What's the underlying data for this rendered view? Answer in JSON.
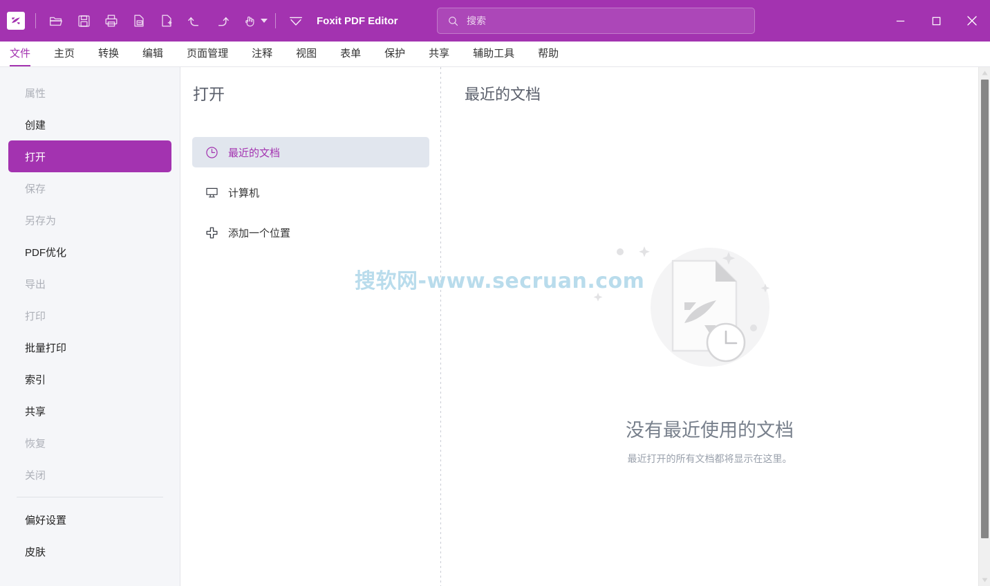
{
  "titlebar": {
    "app_name": "Foxit PDF Editor",
    "logo_icon": "foxit-logo-icon",
    "tools": [
      {
        "name": "open-file-icon",
        "label": "打开"
      },
      {
        "name": "save-icon",
        "label": "保存"
      },
      {
        "name": "print-icon",
        "label": "打印"
      },
      {
        "name": "document-properties-icon",
        "label": "属性"
      },
      {
        "name": "new-document-icon",
        "label": "新建"
      },
      {
        "name": "undo-icon",
        "label": "撤销"
      },
      {
        "name": "redo-icon",
        "label": "重做"
      },
      {
        "name": "hand-tool-icon",
        "label": "手形工具"
      }
    ],
    "customize_icon": "customize-toolbar-icon",
    "window_buttons": [
      {
        "name": "minimize-button",
        "glyph": "minimize"
      },
      {
        "name": "maximize-button",
        "glyph": "maximize"
      },
      {
        "name": "close-button",
        "glyph": "close"
      }
    ]
  },
  "search": {
    "placeholder": "搜索",
    "value": "",
    "icon": "search-icon"
  },
  "menubar": {
    "active": "文件",
    "items": [
      {
        "label": "文件",
        "active": true
      },
      {
        "label": "主页",
        "active": false
      },
      {
        "label": "转换",
        "active": false
      },
      {
        "label": "编辑",
        "active": false
      },
      {
        "label": "页面管理",
        "active": false
      },
      {
        "label": "注释",
        "active": false
      },
      {
        "label": "视图",
        "active": false
      },
      {
        "label": "表单",
        "active": false
      },
      {
        "label": "保护",
        "active": false
      },
      {
        "label": "共享",
        "active": false
      },
      {
        "label": "辅助工具",
        "active": false
      },
      {
        "label": "帮助",
        "active": false
      }
    ]
  },
  "sidebar": {
    "items": [
      {
        "label": "属性",
        "state": "disabled"
      },
      {
        "label": "创建",
        "state": "normal"
      },
      {
        "label": "打开",
        "state": "active"
      },
      {
        "label": "保存",
        "state": "disabled"
      },
      {
        "label": "另存为",
        "state": "disabled"
      },
      {
        "label": "PDF优化",
        "state": "normal"
      },
      {
        "label": "导出",
        "state": "disabled"
      },
      {
        "label": "打印",
        "state": "disabled"
      },
      {
        "label": "批量打印",
        "state": "normal"
      },
      {
        "label": "索引",
        "state": "normal"
      },
      {
        "label": "共享",
        "state": "normal"
      },
      {
        "label": "恢复",
        "state": "disabled"
      },
      {
        "label": "关闭",
        "state": "disabled"
      }
    ],
    "footer_items": [
      {
        "label": "偏好设置",
        "state": "normal"
      },
      {
        "label": "皮肤",
        "state": "normal"
      }
    ]
  },
  "midpanel": {
    "title": "打开",
    "items": [
      {
        "label": "最近的文档",
        "icon": "clock-icon",
        "selected": true
      },
      {
        "label": "计算机",
        "icon": "computer-icon",
        "selected": false
      },
      {
        "label": "添加一个位置",
        "icon": "plus-icon",
        "selected": false
      }
    ]
  },
  "rightpanel": {
    "title": "最近的文档",
    "empty_state": {
      "illustration": "recent-document-clock-illustration",
      "heading": "没有最近使用的文档",
      "subtext": "最近打开的所有文档都将显示在这里。"
    }
  },
  "watermark": {
    "text": "搜软网-www.secruan.com"
  },
  "scrollbar": {
    "up_arrow": "scroll-up-arrow-icon",
    "down_arrow": "scroll-down-arrow-icon"
  },
  "colors": {
    "brand_purple": "#a333b0",
    "sidebar_bg": "#f5f6f9",
    "selected_mid": "#e1e6ee",
    "watermark": "#b9dcec"
  }
}
